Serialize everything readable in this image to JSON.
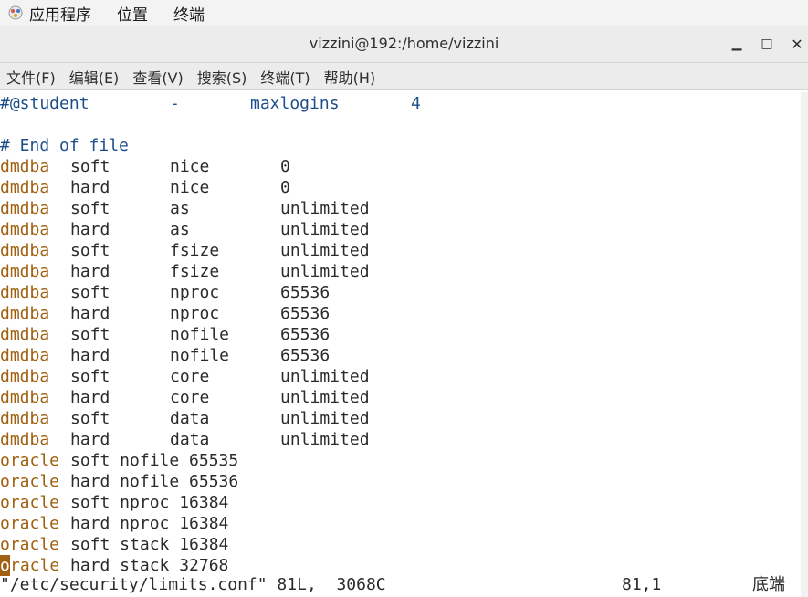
{
  "topbar": {
    "apps_label": "应用程序",
    "places_label": "位置",
    "terminal_label": "终端"
  },
  "window": {
    "title": "vizzini@192:/home/vizzini",
    "minimize_glyph": "▁",
    "maximize_glyph": "□",
    "close_glyph": "✕"
  },
  "menubar": {
    "items": [
      "文件(F)",
      "编辑(E)",
      "查看(V)",
      "搜索(S)",
      "终端(T)",
      "帮助(H)"
    ]
  },
  "editor": {
    "comment_line": [
      "#@student",
      "-",
      "maxlogins",
      "4"
    ],
    "end_comment": "# End of file",
    "limit_rows": [
      [
        "dmdba",
        "soft",
        "nice",
        "0"
      ],
      [
        "dmdba",
        "hard",
        "nice",
        "0"
      ],
      [
        "dmdba",
        "soft",
        "as",
        "unlimited"
      ],
      [
        "dmdba",
        "hard",
        "as",
        "unlimited"
      ],
      [
        "dmdba",
        "soft",
        "fsize",
        "unlimited"
      ],
      [
        "dmdba",
        "hard",
        "fsize",
        "unlimited"
      ],
      [
        "dmdba",
        "soft",
        "nproc",
        "65536"
      ],
      [
        "dmdba",
        "hard",
        "nproc",
        "65536"
      ],
      [
        "dmdba",
        "soft",
        "nofile",
        "65536"
      ],
      [
        "dmdba",
        "hard",
        "nofile",
        "65536"
      ],
      [
        "dmdba",
        "soft",
        "core",
        "unlimited"
      ],
      [
        "dmdba",
        "hard",
        "core",
        "unlimited"
      ],
      [
        "dmdba",
        "soft",
        "data",
        "unlimited"
      ],
      [
        "dmdba",
        "hard",
        "data",
        "unlimited"
      ]
    ],
    "oracle_rows": [
      [
        "oracle",
        "soft nofile 65535"
      ],
      [
        "oracle",
        "hard nofile 65536"
      ],
      [
        "oracle",
        "soft nproc 16384"
      ],
      [
        "oracle",
        "hard nproc 16384"
      ],
      [
        "oracle",
        "soft stack 16384"
      ]
    ],
    "last_row": {
      "cursor_char": "o",
      "user_rest": "racle",
      "rest": "hard stack 32768"
    },
    "status": {
      "file_info": "\"/etc/security/limits.conf\" 81L,  3068C",
      "position": "81,1",
      "scroll": "底端"
    },
    "colors": {
      "comment": "#1c4e8a",
      "user": "#a0600f",
      "text": "#2b2b2b"
    }
  }
}
